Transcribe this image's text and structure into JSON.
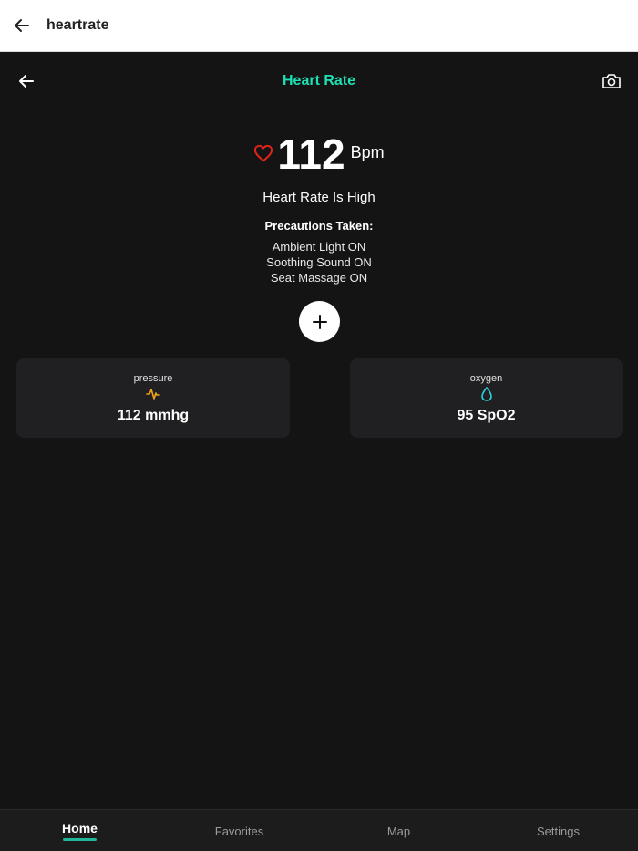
{
  "app_bar": {
    "title": "heartrate",
    "back_icon": "arrow-left-icon"
  },
  "header": {
    "title": "Heart Rate",
    "title_color": "#1fe0b4",
    "back_icon": "arrow-left-icon",
    "camera_icon": "camera-icon"
  },
  "heart_rate": {
    "value": "112",
    "unit": "Bpm",
    "icon": "heart-outline-icon",
    "icon_color": "#e0241b"
  },
  "status": "Heart Rate Is High",
  "precautions": {
    "title": "Precautions Taken:",
    "items": [
      "Ambient Light ON",
      "Soothing Sound ON",
      "Seat Massage ON"
    ]
  },
  "add_button": {
    "icon": "plus-icon"
  },
  "cards": [
    {
      "label": "pressure",
      "value": "112 mmhg",
      "icon": "pulse-icon",
      "icon_color": "#f2a21b"
    },
    {
      "label": "oxygen",
      "value": "95 SpO2",
      "icon": "water-drop-icon",
      "icon_color": "#2fd0d8"
    }
  ],
  "bottom_nav": {
    "items": [
      "Home",
      "Favorites",
      "Map",
      "Settings"
    ],
    "active": "Home",
    "active_color": "#1fb89a"
  }
}
